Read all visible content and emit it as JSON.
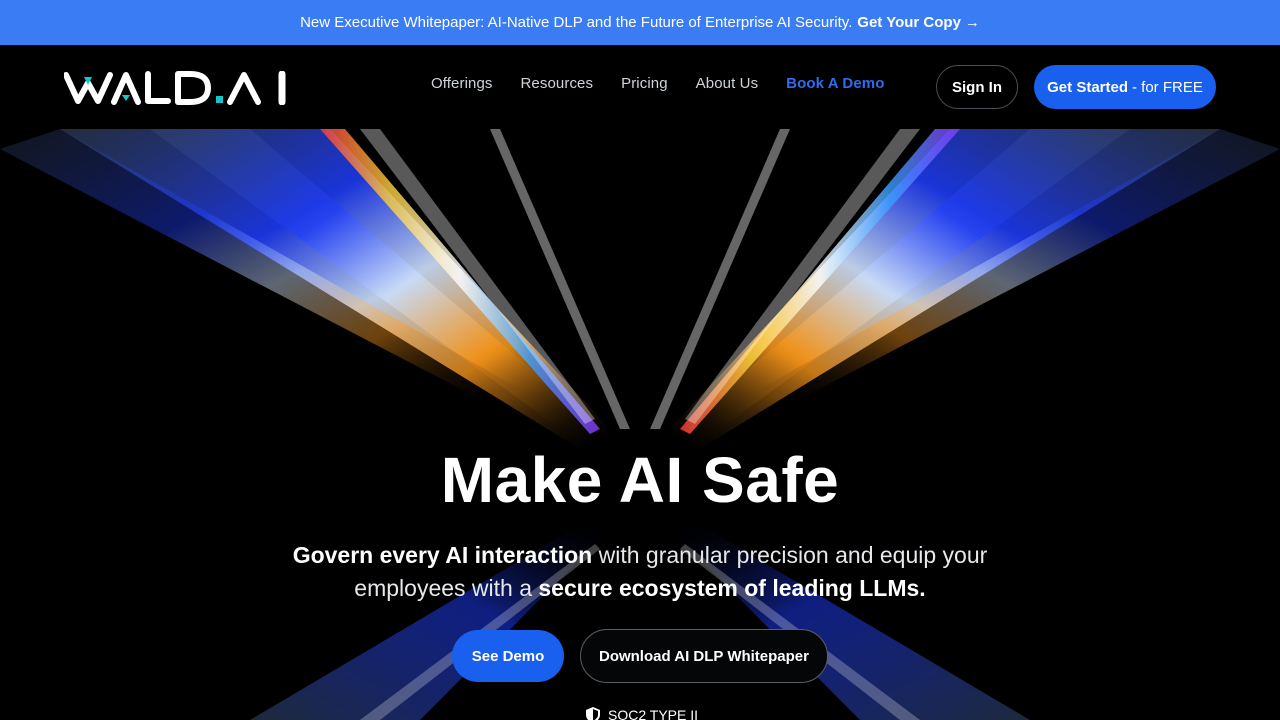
{
  "announcement": {
    "text": "New Executive Whitepaper: AI-Native DLP and the Future of Enterprise AI Security.",
    "cta": "Get Your Copy",
    "arrow": "→"
  },
  "header": {
    "logo_text": "WALD.AI",
    "nav": [
      {
        "label": "Offerings"
      },
      {
        "label": "Resources"
      },
      {
        "label": "Pricing"
      },
      {
        "label": "About Us"
      },
      {
        "label": "Book A Demo"
      }
    ],
    "sign_in": "Sign In",
    "get_started_bold": "Get Started",
    "get_started_rest": "- for FREE"
  },
  "hero": {
    "headline": "Make AI Safe",
    "sub_bold_1": "Govern every AI interaction",
    "sub_text_1": " with granular precision and equip your employees with a ",
    "sub_bold_2": "secure ecosystem of leading LLMs.",
    "see_demo": "See Demo",
    "download": "Download AI DLP Whitepaper",
    "badge": "SOC2 TYPE II"
  },
  "colors": {
    "announcement_bg": "#3a7cf3",
    "primary_button": "#1a60ee",
    "demo_link": "#2f6cf0",
    "background": "#000000"
  }
}
